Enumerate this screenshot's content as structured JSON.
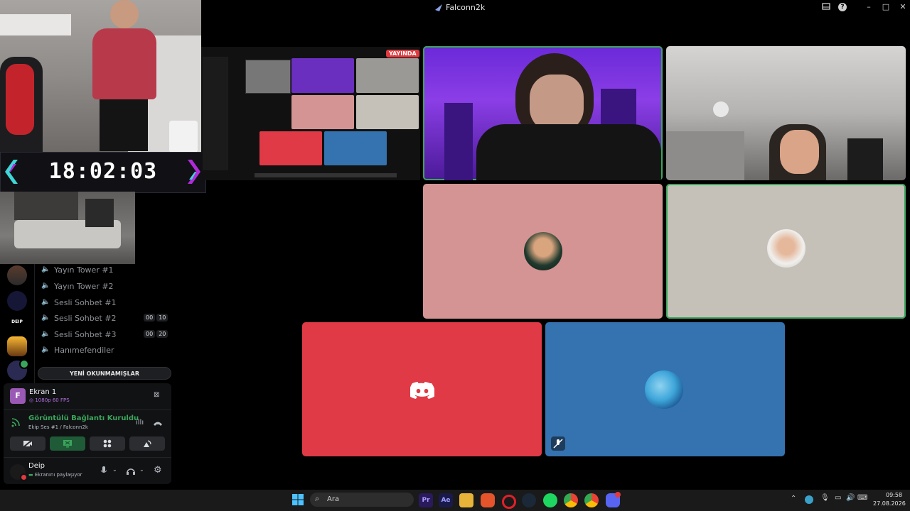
{
  "window": {
    "title": "Falconn2k"
  },
  "overlay": {
    "clock": "18:02:03"
  },
  "preview": {
    "live_badge": "YAYINDA"
  },
  "channels": [
    {
      "name": "Yayın Tower #1"
    },
    {
      "name": "Yayın Tower #2"
    },
    {
      "name": "Sesli Sohbet #1"
    },
    {
      "name": "Sesli Sohbet #2",
      "count_a": "00",
      "count_b": "10"
    },
    {
      "name": "Sesli Sohbet #3",
      "count_a": "00",
      "count_b": "20"
    },
    {
      "name": "Hanımefendiler"
    }
  ],
  "server_rail": {
    "label": "DEIP"
  },
  "unread_button": "YENİ OKUNMAMIŞLAR",
  "stream": {
    "avatar_letter": "F",
    "name": "Ekran 1",
    "quality": "1080p 60 FPS"
  },
  "connection": {
    "status": "Görüntülü Bağlantı Kuruldu",
    "channel": "Ekip Ses #1 / Falconn2k"
  },
  "user": {
    "name": "Deip",
    "status": "Ekranını paylaşıyor"
  },
  "taskbar": {
    "search_placeholder": "Ara",
    "premiere_label": "Pr",
    "aftereffects_label": "Ae",
    "time": "09:58",
    "date": "27.08.2026"
  },
  "colors": {
    "accent_green": "#3ba55c",
    "discord_red": "#e03a46",
    "tile_blue": "#3572b0",
    "tile_pink": "#d49494",
    "tile_gray": "#c5c1b9",
    "live_red": "#e03a3e"
  }
}
